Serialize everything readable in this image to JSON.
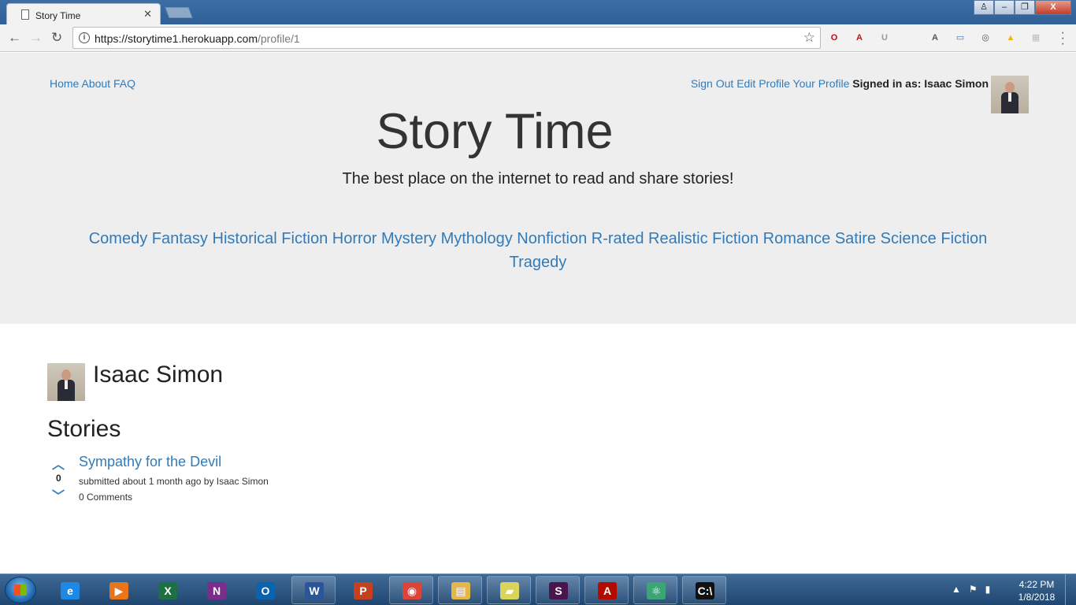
{
  "browser": {
    "tab_title": "Story Time",
    "tab_close": "✕",
    "url_host": "https://storytime1.herokuapp.com",
    "url_path": "/profile/1",
    "back_glyph": "←",
    "forward_glyph": "→",
    "reload_glyph": "↻",
    "star_glyph": "☆",
    "window_min": "–",
    "window_max": "❐",
    "window_close": "X",
    "extensions": [
      {
        "name": "opera-icon",
        "glyph": "O",
        "color": "#d0021b"
      },
      {
        "name": "pdf-icon",
        "glyph": "A",
        "color": "#b11a1a"
      },
      {
        "name": "ublock-icon",
        "glyph": "U",
        "color": "#9a9a9a"
      },
      {
        "name": "blank-ext-icon",
        "glyph": "",
        "color": "#cfcfcf"
      },
      {
        "name": "angular-icon",
        "glyph": "A",
        "color": "#555555"
      },
      {
        "name": "screenshot-icon",
        "glyph": "▭",
        "color": "#3a78c2"
      },
      {
        "name": "chromecast-icon",
        "glyph": "◎",
        "color": "#555555"
      },
      {
        "name": "drive-icon",
        "glyph": "▲",
        "color": "#f4b400"
      },
      {
        "name": "grid-ext-icon",
        "glyph": "▦",
        "color": "#bdbdbd"
      }
    ]
  },
  "nav": {
    "home": "Home",
    "about": "About",
    "faq": "FAQ",
    "sign_out": "Sign Out",
    "edit_profile": "Edit Profile",
    "your_profile": "Your Profile",
    "signed_in_as": "Signed in as: Isaac Simon"
  },
  "hero": {
    "title": "Story Time",
    "tagline": "The best place on the internet to read and share stories!"
  },
  "genres": [
    "Comedy",
    "Fantasy",
    "Historical Fiction",
    "Horror",
    "Mystery",
    "Mythology",
    "Nonfiction",
    "R-rated",
    "Realistic Fiction",
    "Romance",
    "Satire",
    "Science Fiction",
    "Tragedy"
  ],
  "profile": {
    "name": "Isaac Simon",
    "stories_heading": "Stories",
    "stories": [
      {
        "title": "Sympathy for the Devil",
        "votes": "0",
        "meta": "submitted about 1 month ago by Isaac Simon",
        "comments": "0 Comments"
      }
    ]
  },
  "taskbar": {
    "apps": [
      {
        "name": "ie-icon",
        "glyph": "e",
        "color": "#1e88e5",
        "plain": true
      },
      {
        "name": "media-player-icon",
        "glyph": "▶",
        "color": "#e8741c",
        "plain": true
      },
      {
        "name": "excel-icon",
        "glyph": "X",
        "color": "#1d7044",
        "plain": true
      },
      {
        "name": "onenote-icon",
        "glyph": "N",
        "color": "#7b2c8c",
        "plain": true
      },
      {
        "name": "outlook-icon",
        "glyph": "O",
        "color": "#0a64ad",
        "plain": true
      },
      {
        "name": "word-icon",
        "glyph": "W",
        "color": "#2a5699",
        "plain": false
      },
      {
        "name": "powerpoint-icon",
        "glyph": "P",
        "color": "#c4401f",
        "plain": true
      },
      {
        "name": "chrome-icon",
        "glyph": "◉",
        "color": "#db4437",
        "plain": false
      },
      {
        "name": "explorer-icon",
        "glyph": "▤",
        "color": "#e5b648",
        "plain": false
      },
      {
        "name": "sticky-notes-icon",
        "glyph": "▰",
        "color": "#d9d45c",
        "plain": false
      },
      {
        "name": "slack-icon",
        "glyph": "S",
        "color": "#4a154b",
        "plain": false
      },
      {
        "name": "acrobat-icon",
        "glyph": "A",
        "color": "#b30b00",
        "plain": false
      },
      {
        "name": "atom-icon",
        "glyph": "⚛",
        "color": "#3aa675",
        "plain": false
      },
      {
        "name": "cmd-icon",
        "glyph": "C:\\",
        "color": "#111111",
        "plain": false
      }
    ],
    "tray_glyphs": [
      "▲",
      "⚑",
      "▮"
    ],
    "time": "4:22 PM",
    "date": "1/8/2018"
  }
}
